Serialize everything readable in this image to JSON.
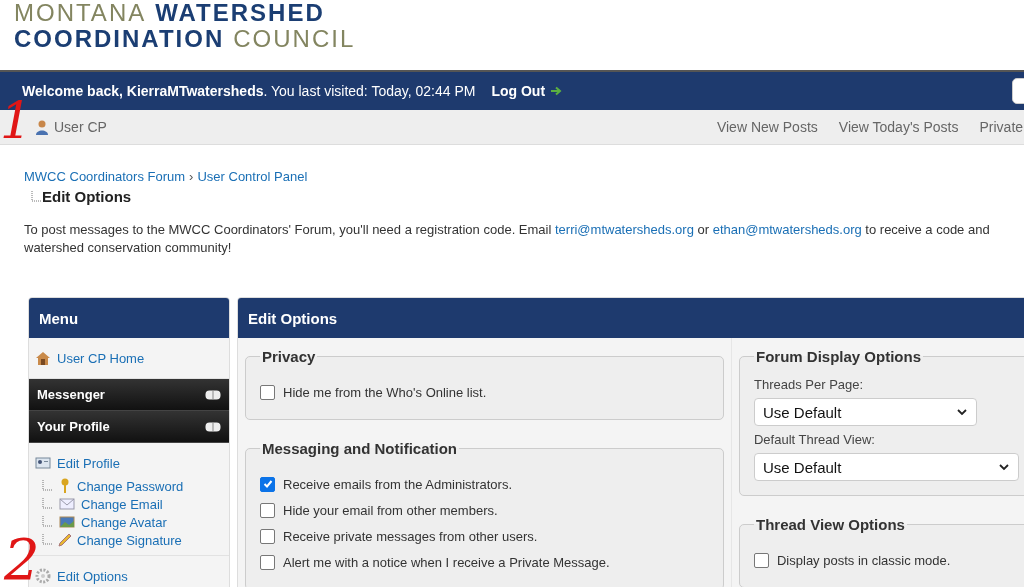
{
  "logo": {
    "lines": [
      [
        {
          "kind": "light",
          "text": "MONTANA"
        },
        {
          "kind": "bold",
          "text": "WATERSHED"
        }
      ],
      [
        {
          "kind": "bold",
          "text": "COORDINATION"
        },
        {
          "kind": "light",
          "text": "COUNCIL"
        }
      ]
    ]
  },
  "top_bar": {
    "welcome": "**Welcome back, KierraMTwatersheds**. You last visited: Today, 02:44 PM",
    "logout": "Log Out"
  },
  "nav_bar": {
    "user_cp": "User CP",
    "links": [
      "View New Posts",
      "View Today's Posts",
      "Private"
    ]
  },
  "breadcrumb": {
    "items": [
      "MWCC Coordinators Forum",
      "User Control Panel"
    ],
    "separator": "›",
    "current": "Edit Options"
  },
  "notice": {
    "lines": [
      [
        {
          "kind": "text",
          "text": "To post messages to the MWCC Coordinators' Forum, you'll need a registration code. Email "
        },
        {
          "kind": "link",
          "text": "terri@mtwatersheds.org"
        },
        {
          "kind": "text",
          "text": " or "
        },
        {
          "kind": "link",
          "text": "ethan@mtwatersheds.org"
        },
        {
          "kind": "text",
          "text": " to receive a code and"
        }
      ],
      [
        {
          "kind": "text",
          "text": "watershed conservation community!"
        }
      ]
    ]
  },
  "menu": {
    "title": "Menu",
    "items": [
      {
        "kind": "link",
        "label": "User CP Home"
      },
      {
        "kind": "section",
        "label": "Messenger"
      },
      {
        "kind": "section",
        "label": "Your Profile"
      },
      {
        "kind": "link",
        "label": "Edit Profile",
        "children": [
          {
            "label": "Change Password"
          },
          {
            "label": "Change Email"
          },
          {
            "label": "Change Avatar"
          },
          {
            "label": "Change Signature"
          }
        ]
      },
      {
        "kind": "link",
        "label": "Edit Options"
      }
    ]
  },
  "main": {
    "title": "Edit Options",
    "columns": [
      [
        {
          "legend": "Privacy",
          "controls": [
            {
              "kind": "checkbox",
              "label": "Hide me from the Who's Online list.",
              "checked": false
            }
          ]
        },
        {
          "legend": "Messaging and Notification",
          "controls": [
            {
              "kind": "checkbox",
              "label": "Receive emails from the Administrators.",
              "checked": true
            },
            {
              "kind": "checkbox",
              "label": "Hide your email from other members.",
              "checked": false
            },
            {
              "kind": "checkbox",
              "label": "Receive private messages from other users.",
              "checked": false
            },
            {
              "kind": "checkbox",
              "label": "Alert me with a notice when I receive a Private Message.",
              "checked": false
            }
          ]
        }
      ],
      [
        {
          "legend": "Forum Display Options",
          "controls": [
            {
              "kind": "select",
              "label": "Threads Per Page:",
              "value": "Use Default"
            },
            {
              "kind": "select",
              "label": "Default Thread View:",
              "value": "Use Default"
            }
          ]
        },
        {
          "legend": "Thread View Options",
          "controls": [
            {
              "kind": "checkbox",
              "label": "Display posts in classic mode.",
              "checked": false
            }
          ]
        }
      ]
    ]
  },
  "annotations": [
    "1",
    "2"
  ]
}
